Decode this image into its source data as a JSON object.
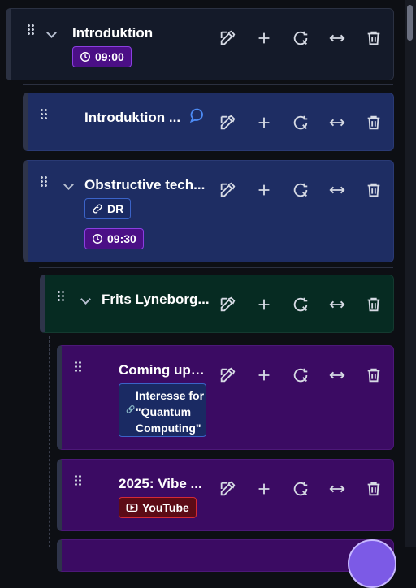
{
  "items": [
    {
      "title": "Introduktion",
      "time": "09:00"
    },
    {
      "title": "Introduktion ..."
    },
    {
      "title": "Obstructive tech...",
      "link": "DR",
      "time": "09:30"
    },
    {
      "title": "Frits Lyneborg..."
    },
    {
      "title": "Coming up:...",
      "note": "Interesse for \"Quantum Computing\""
    },
    {
      "title": "2025: Vibe ...",
      "source": "YouTube"
    }
  ],
  "icons": [
    "drag-handle-icon",
    "chevron-down-icon",
    "edit-icon",
    "plus-icon",
    "rotate-icon",
    "resize-horizontal-icon",
    "trash-icon",
    "comment-icon",
    "clock-icon",
    "link-icon",
    "youtube-icon"
  ],
  "colors": {
    "background": "#0d0f14",
    "card_dark": "#141a29",
    "card_blue": "#1e2d63",
    "card_green": "#062b22",
    "card_purple": "#3b0b63",
    "time_badge": "#4b0f86",
    "youtube_badge": "#5c0b16",
    "comment_icon": "#4d8bf5"
  }
}
